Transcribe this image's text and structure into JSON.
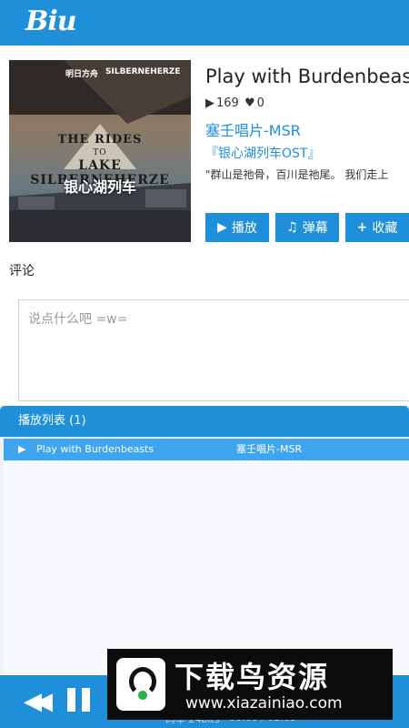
{
  "app": {
    "logo": "Biu",
    "brand_color": "#1e8fd8"
  },
  "song": {
    "title": "Play with Burdenbeasts",
    "plays": "169",
    "likes": "0",
    "artist": "塞壬唱片-MSR",
    "album": "『银心湖列车OST』",
    "description": "\"群山是祂骨，百川是祂尾。 我们走上"
  },
  "cover": {
    "badge_left": "明日方舟",
    "badge_right": "SILBERNEHERZE",
    "line1": "THE RIDES",
    "line2": "TO",
    "line3": "LAKE SILBERNEHERZE",
    "line4": "银心湖列车"
  },
  "actions": {
    "play": {
      "label": "播放",
      "icon": "play-icon"
    },
    "danmaku": {
      "label": "弹幕",
      "icon": "music-note-icon"
    },
    "favorite": {
      "label": "收藏",
      "icon": "plus-icon"
    }
  },
  "comments": {
    "label": "评论",
    "placeholder": "说点什么吧 =w="
  },
  "playlist": {
    "header": "播放列表 (1)",
    "items": [
      {
        "title": "Play with Burdenbeasts",
        "artist": "塞壬唱片-MSR"
      }
    ]
  },
  "player": {
    "quality": "码率 24bits",
    "time": "00:00 / 02:03"
  },
  "watermark": {
    "name": "下载鸟资源",
    "url": "www.xiazainiao.com"
  }
}
